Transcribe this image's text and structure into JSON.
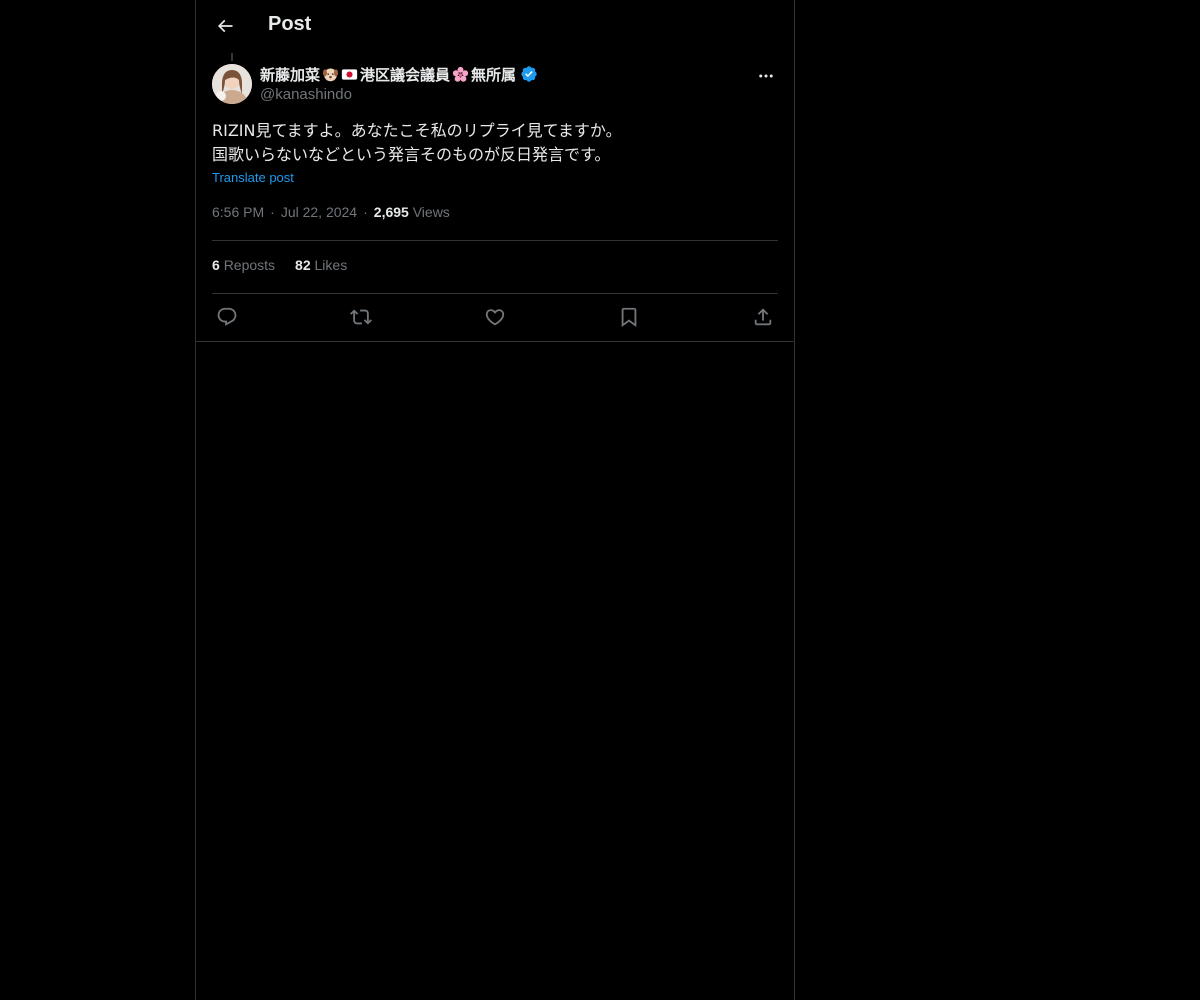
{
  "header": {
    "title": "Post"
  },
  "author": {
    "name_part1": "新藤加菜",
    "name_part2": "港区議会議員",
    "name_part3": "無所属",
    "handle": "@kanashindo",
    "verified_color": "#1d9bf0"
  },
  "post": {
    "text": "RIZIN見てますよ。あなたこそ私のリプライ見てますか。\n国歌いらないなどという発言そのものが反日発言です。",
    "translate_label": "Translate post",
    "time": "6:56 PM",
    "date": "Jul 22, 2024",
    "views_count": "2,695",
    "views_label": "Views"
  },
  "stats": {
    "reposts_count": "6",
    "reposts_label": "Reposts",
    "likes_count": "82",
    "likes_label": "Likes"
  },
  "actions": [
    "reply-icon",
    "repost-icon",
    "like-icon",
    "bookmark-icon",
    "share-icon"
  ],
  "colors": {
    "background": "#000000",
    "text": "#e7e9ea",
    "muted": "#71767b",
    "accent": "#1d9bf0",
    "border": "#2f3336"
  }
}
